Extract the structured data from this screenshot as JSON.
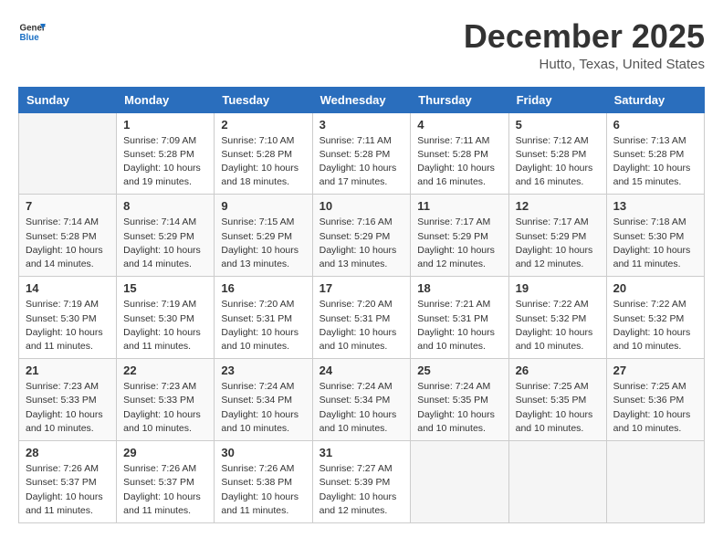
{
  "header": {
    "logo_general": "General",
    "logo_blue": "Blue",
    "month_title": "December 2025",
    "location": "Hutto, Texas, United States"
  },
  "days_of_week": [
    "Sunday",
    "Monday",
    "Tuesday",
    "Wednesday",
    "Thursday",
    "Friday",
    "Saturday"
  ],
  "weeks": [
    [
      {
        "num": "",
        "empty": true
      },
      {
        "num": "1",
        "sunrise": "7:09 AM",
        "sunset": "5:28 PM",
        "daylight": "10 hours and 19 minutes."
      },
      {
        "num": "2",
        "sunrise": "7:10 AM",
        "sunset": "5:28 PM",
        "daylight": "10 hours and 18 minutes."
      },
      {
        "num": "3",
        "sunrise": "7:11 AM",
        "sunset": "5:28 PM",
        "daylight": "10 hours and 17 minutes."
      },
      {
        "num": "4",
        "sunrise": "7:11 AM",
        "sunset": "5:28 PM",
        "daylight": "10 hours and 16 minutes."
      },
      {
        "num": "5",
        "sunrise": "7:12 AM",
        "sunset": "5:28 PM",
        "daylight": "10 hours and 16 minutes."
      },
      {
        "num": "6",
        "sunrise": "7:13 AM",
        "sunset": "5:28 PM",
        "daylight": "10 hours and 15 minutes."
      }
    ],
    [
      {
        "num": "7",
        "sunrise": "7:14 AM",
        "sunset": "5:28 PM",
        "daylight": "10 hours and 14 minutes."
      },
      {
        "num": "8",
        "sunrise": "7:14 AM",
        "sunset": "5:29 PM",
        "daylight": "10 hours and 14 minutes."
      },
      {
        "num": "9",
        "sunrise": "7:15 AM",
        "sunset": "5:29 PM",
        "daylight": "10 hours and 13 minutes."
      },
      {
        "num": "10",
        "sunrise": "7:16 AM",
        "sunset": "5:29 PM",
        "daylight": "10 hours and 13 minutes."
      },
      {
        "num": "11",
        "sunrise": "7:17 AM",
        "sunset": "5:29 PM",
        "daylight": "10 hours and 12 minutes."
      },
      {
        "num": "12",
        "sunrise": "7:17 AM",
        "sunset": "5:29 PM",
        "daylight": "10 hours and 12 minutes."
      },
      {
        "num": "13",
        "sunrise": "7:18 AM",
        "sunset": "5:30 PM",
        "daylight": "10 hours and 11 minutes."
      }
    ],
    [
      {
        "num": "14",
        "sunrise": "7:19 AM",
        "sunset": "5:30 PM",
        "daylight": "10 hours and 11 minutes."
      },
      {
        "num": "15",
        "sunrise": "7:19 AM",
        "sunset": "5:30 PM",
        "daylight": "10 hours and 11 minutes."
      },
      {
        "num": "16",
        "sunrise": "7:20 AM",
        "sunset": "5:31 PM",
        "daylight": "10 hours and 10 minutes."
      },
      {
        "num": "17",
        "sunrise": "7:20 AM",
        "sunset": "5:31 PM",
        "daylight": "10 hours and 10 minutes."
      },
      {
        "num": "18",
        "sunrise": "7:21 AM",
        "sunset": "5:31 PM",
        "daylight": "10 hours and 10 minutes."
      },
      {
        "num": "19",
        "sunrise": "7:22 AM",
        "sunset": "5:32 PM",
        "daylight": "10 hours and 10 minutes."
      },
      {
        "num": "20",
        "sunrise": "7:22 AM",
        "sunset": "5:32 PM",
        "daylight": "10 hours and 10 minutes."
      }
    ],
    [
      {
        "num": "21",
        "sunrise": "7:23 AM",
        "sunset": "5:33 PM",
        "daylight": "10 hours and 10 minutes."
      },
      {
        "num": "22",
        "sunrise": "7:23 AM",
        "sunset": "5:33 PM",
        "daylight": "10 hours and 10 minutes."
      },
      {
        "num": "23",
        "sunrise": "7:24 AM",
        "sunset": "5:34 PM",
        "daylight": "10 hours and 10 minutes."
      },
      {
        "num": "24",
        "sunrise": "7:24 AM",
        "sunset": "5:34 PM",
        "daylight": "10 hours and 10 minutes."
      },
      {
        "num": "25",
        "sunrise": "7:24 AM",
        "sunset": "5:35 PM",
        "daylight": "10 hours and 10 minutes."
      },
      {
        "num": "26",
        "sunrise": "7:25 AM",
        "sunset": "5:35 PM",
        "daylight": "10 hours and 10 minutes."
      },
      {
        "num": "27",
        "sunrise": "7:25 AM",
        "sunset": "5:36 PM",
        "daylight": "10 hours and 10 minutes."
      }
    ],
    [
      {
        "num": "28",
        "sunrise": "7:26 AM",
        "sunset": "5:37 PM",
        "daylight": "10 hours and 11 minutes."
      },
      {
        "num": "29",
        "sunrise": "7:26 AM",
        "sunset": "5:37 PM",
        "daylight": "10 hours and 11 minutes."
      },
      {
        "num": "30",
        "sunrise": "7:26 AM",
        "sunset": "5:38 PM",
        "daylight": "10 hours and 11 minutes."
      },
      {
        "num": "31",
        "sunrise": "7:27 AM",
        "sunset": "5:39 PM",
        "daylight": "10 hours and 12 minutes."
      },
      {
        "num": "",
        "empty": true
      },
      {
        "num": "",
        "empty": true
      },
      {
        "num": "",
        "empty": true
      }
    ]
  ]
}
